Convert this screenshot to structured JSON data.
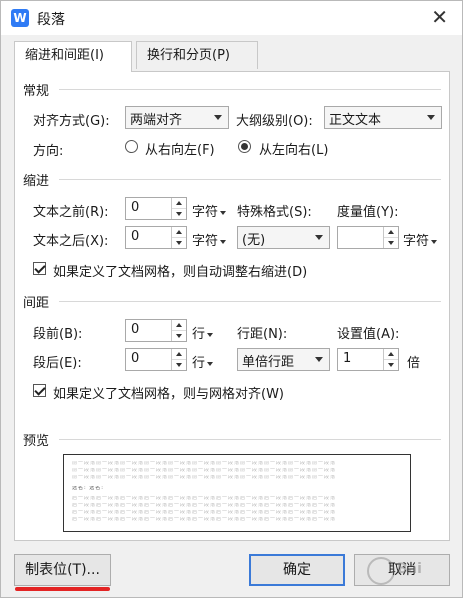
{
  "window": {
    "title": "段落",
    "app_icon_letter": "W"
  },
  "tabs": [
    {
      "label": "缩进和间距(I)",
      "active": true
    },
    {
      "label": "换行和分页(P)",
      "active": false
    }
  ],
  "general": {
    "title": "常规",
    "alignment_label": "对齐方式(G):",
    "alignment_value": "两端对齐",
    "outline_label": "大纲级别(O):",
    "outline_value": "正文文本",
    "direction_label": "方向:",
    "direction_rtl": "从右向左(F)",
    "direction_ltr": "从左向右(L)",
    "direction_selected": "ltr"
  },
  "indent": {
    "title": "缩进",
    "before_label": "文本之前(R):",
    "before_value": "0",
    "before_unit": "字符",
    "after_label": "文本之后(X):",
    "after_value": "0",
    "after_unit": "字符",
    "special_label": "特殊格式(S):",
    "special_value": "(无)",
    "measure_label": "度量值(Y):",
    "measure_value": "",
    "measure_unit": "字符",
    "auto_adjust_label": "如果定义了文档网格，则自动调整右缩进(D)",
    "auto_adjust_checked": true
  },
  "spacing": {
    "title": "间距",
    "before_label": "段前(B):",
    "before_value": "0",
    "before_unit": "行",
    "after_label": "段后(E):",
    "after_value": "0",
    "after_unit": "行",
    "line_label": "行距(N):",
    "line_value": "单倍行距",
    "setting_label": "设置值(A):",
    "setting_value": "1",
    "setting_unit": "倍",
    "snap_grid_label": "如果定义了文档网格，则与网格对齐(W)",
    "snap_grid_checked": true
  },
  "preview": {
    "title": "预览",
    "prev_text": "前一段落前一段落前一段落前一段落前一段落前一段落前一段落前一段落前一段落前一段落前一段落",
    "sample_text": "选名: 选名:",
    "next_text": "后一段落后一段落后一段落后一段落后一段落后一段落后一段落后一段落后一段落后一段落后一段落"
  },
  "footer": {
    "tabs_button": "制表位(T)...",
    "ok_button": "确定",
    "cancel_button": "取消"
  },
  "watermark": {
    "text": "Bai"
  },
  "colors": {
    "accent": "#3b7ad8",
    "highlight_mark": "#e32424",
    "app_icon": "#2f7bf5"
  }
}
